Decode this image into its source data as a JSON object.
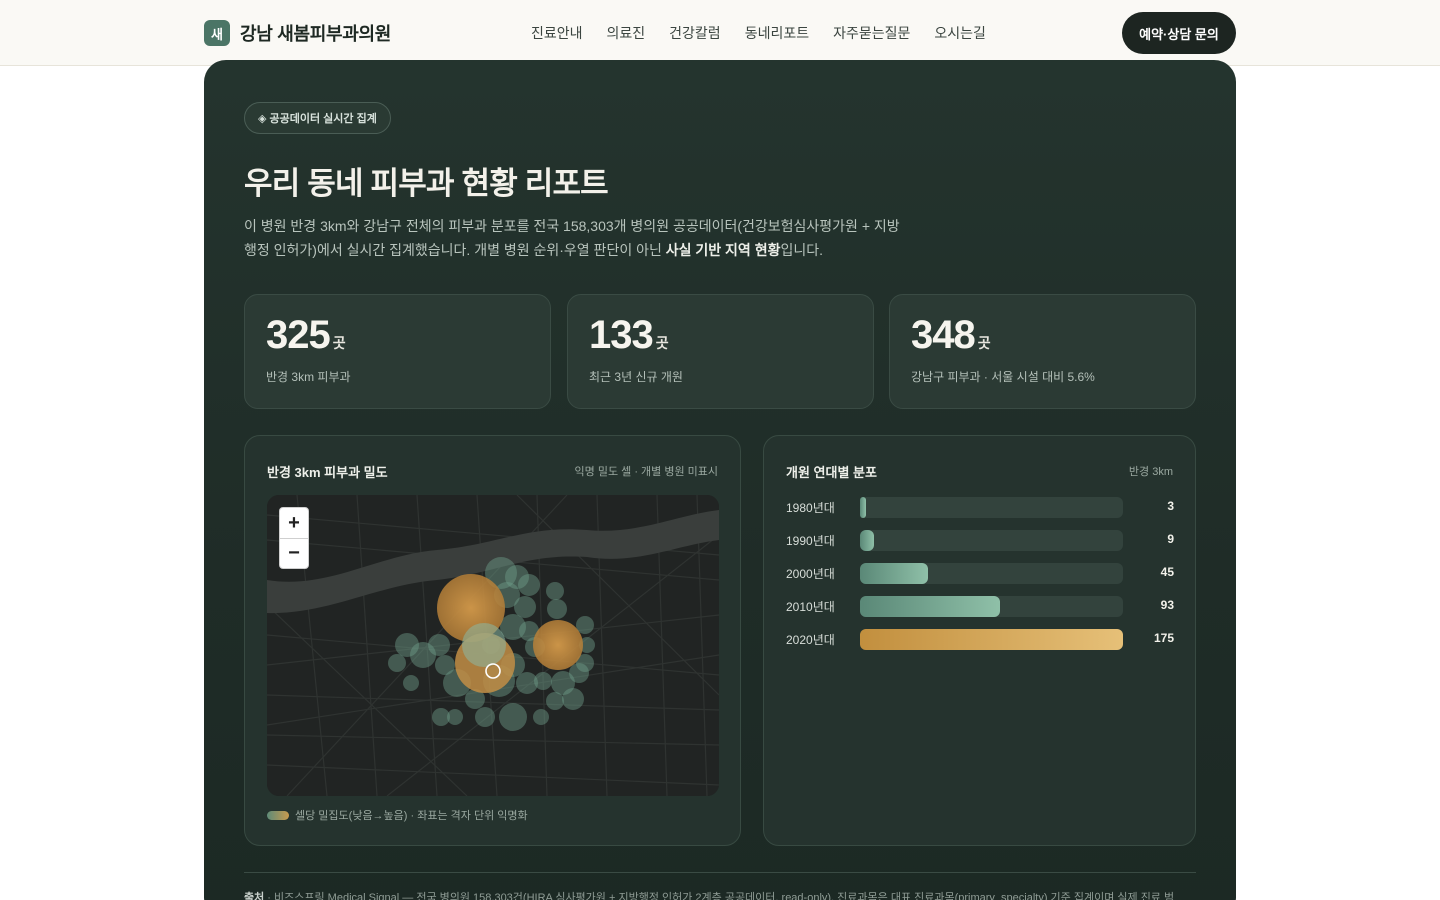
{
  "header": {
    "brand_mark": "새",
    "brand_name": "강남 새봄피부과의원",
    "nav": [
      "진료안내",
      "의료진",
      "건강칼럼",
      "동네리포트",
      "자주묻는질문",
      "오시는길"
    ],
    "cta": "예약·상담 문의"
  },
  "hero": {
    "badge": "◈ 공공데이터 실시간 집계",
    "title": "우리 동네 피부과 현황 리포트",
    "desc_part1": "이 병원 반경 3km와 강남구 전체의 피부과 분포를 전국 158,303개 병의원 공공데이터(건강보험심사평가원 + 지방행정 인허가)에서 실시간 집계했습니다. 개별 병원 순위·우열 판단이 아닌 ",
    "desc_bold": "사실 기반 지역 현황",
    "desc_part2": "입니다."
  },
  "stats": [
    {
      "value": "325",
      "unit": "곳",
      "label": "반경 3km 피부과"
    },
    {
      "value": "133",
      "unit": "곳",
      "label": "최근 3년 신규 개원"
    },
    {
      "value": "348",
      "unit": "곳",
      "label": "강남구 피부과 · 서울 시설 대비 5.6%"
    }
  ],
  "density_card": {
    "title": "반경 3km 피부과 밀도",
    "note": "익명 밀도 셀 · 개별 병원 미표시",
    "zoom_in": "+",
    "zoom_out": "−",
    "legend": "셀당 밀집도(낮음→높음) · 좌표는 격자 단위 익명화",
    "center_marker_icon": "location-ring-icon"
  },
  "chart_data": {
    "type": "bar",
    "title": "개원 연대별 분포",
    "note": "반경 3km",
    "categories": [
      "1980년대",
      "1990년대",
      "2000년대",
      "2010년대",
      "2020년대"
    ],
    "values": [
      3,
      9,
      45,
      93,
      175
    ],
    "xlim": [
      0,
      175
    ],
    "highlight_color": "#d4a45a",
    "base_color": "#6d9d89"
  },
  "footer": {
    "source_label": "출처",
    "source_text": " · 비즈스프링 Medical Signal — 전국 병의원 158,303건(HIRA 심사평가원 + 지방행정 인허가 2계층 공공데이터, read-only). 진료과목은 대표 진료과목(primary_specialty) 기준 집계이며 실제 진료 범"
  }
}
